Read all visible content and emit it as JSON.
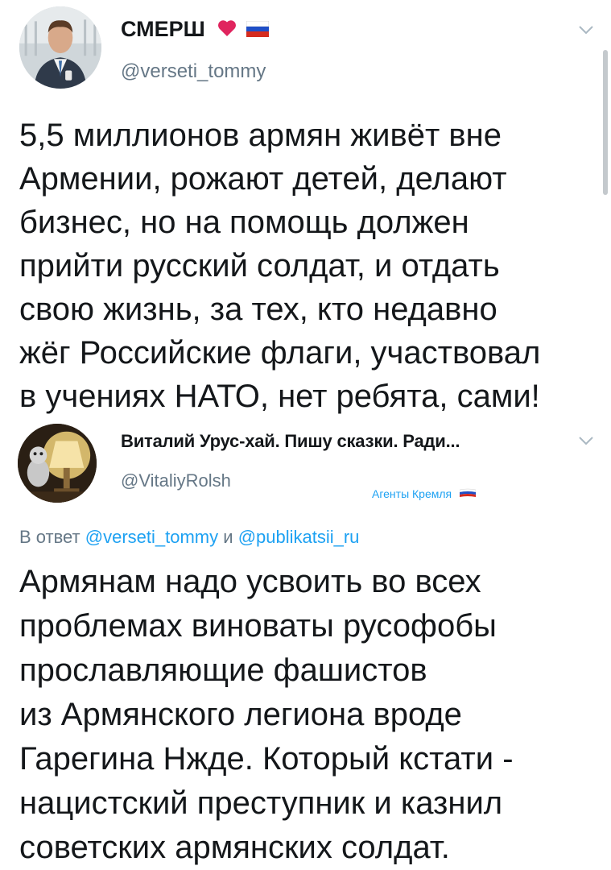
{
  "tweets": [
    {
      "display_name": "СМЕРШ",
      "name_emoji": [
        "heart-emoji",
        "russia-flag-emoji"
      ],
      "handle": "@verseti_tommy",
      "text_lines": [
        "5,5 миллионов армян живёт вне",
        "Армении, рожают детей, делают",
        "бизнес, но на помощь должен",
        "прийти русский солдат, и отдать",
        "свою жизнь, за тех, кто недавно",
        "жёг Российские флаги, участвовал",
        "в учениях НАТО, нет ребята, сами!"
      ]
    },
    {
      "display_name": "Виталий Урус-хай. Пишу сказки. Ради...",
      "handle": "@VitaliyRolsh",
      "badge": "Агенты Кремля",
      "reply_to": {
        "prefix": "В ответ",
        "mention_1": "@verseti_tommy",
        "joiner": "и",
        "mention_2": "@publikatsii_ru"
      },
      "text_lines": [
        "Армянам надо усвоить во всех",
        "проблемах виноваты русофобы",
        "прославляющие фашистов",
        "из Армянского легиона вроде",
        "Гарегина Нжде. Который кстати -",
        "нацистский преступник и казнил",
        "советских армянских солдат."
      ]
    }
  ],
  "colors": {
    "text": "#14171a",
    "secondary": "#657786",
    "link": "#1da1f2",
    "heart": "#e0245e"
  }
}
